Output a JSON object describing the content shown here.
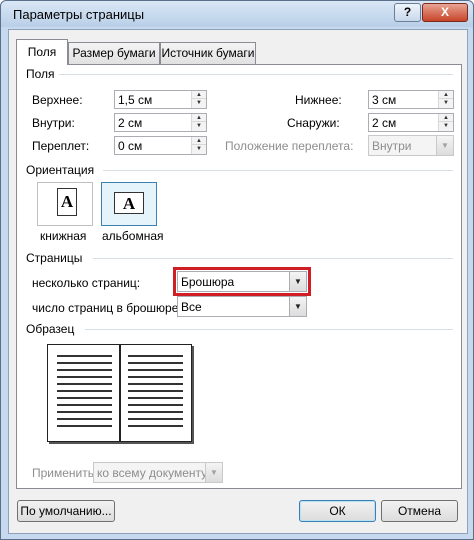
{
  "window": {
    "title": "Параметры страницы",
    "help_label": "?",
    "close_label": "X"
  },
  "tabs": [
    {
      "label": "Поля",
      "active": true
    },
    {
      "label": "Размер бумаги",
      "active": false
    },
    {
      "label": "Источник бумаги",
      "active": false
    }
  ],
  "margins": {
    "group_label": "Поля",
    "top": {
      "label": "Верхнее:",
      "value": "1,5 см"
    },
    "bottom": {
      "label": "Нижнее:",
      "value": "3 см"
    },
    "inside": {
      "label": "Внутри:",
      "value": "2 см"
    },
    "outside": {
      "label": "Снаружи:",
      "value": "2 см"
    },
    "gutter": {
      "label": "Переплет:",
      "value": "0 см"
    },
    "gutter_position": {
      "label": "Положение переплета:",
      "value": "Внутри"
    }
  },
  "orientation": {
    "group_label": "Ориентация",
    "portrait_label": "книжная",
    "landscape_label": "альбомная",
    "icon_letter": "A",
    "selected": "landscape"
  },
  "pages": {
    "group_label": "Страницы",
    "multiple_pages": {
      "label": "несколько страниц:",
      "value": "Брошюра"
    },
    "sheets_per_booklet": {
      "label": "число страниц в брошюре:",
      "value": "Все"
    }
  },
  "preview": {
    "group_label": "Образец"
  },
  "apply": {
    "label": "Применить:",
    "value": "ко всему документу"
  },
  "buttons": {
    "default_label": "По умолчанию...",
    "ok_label": "ОК",
    "cancel_label": "Отмена"
  },
  "colors": {
    "highlight": "#d11d26",
    "selection": "#3c7fb1"
  }
}
